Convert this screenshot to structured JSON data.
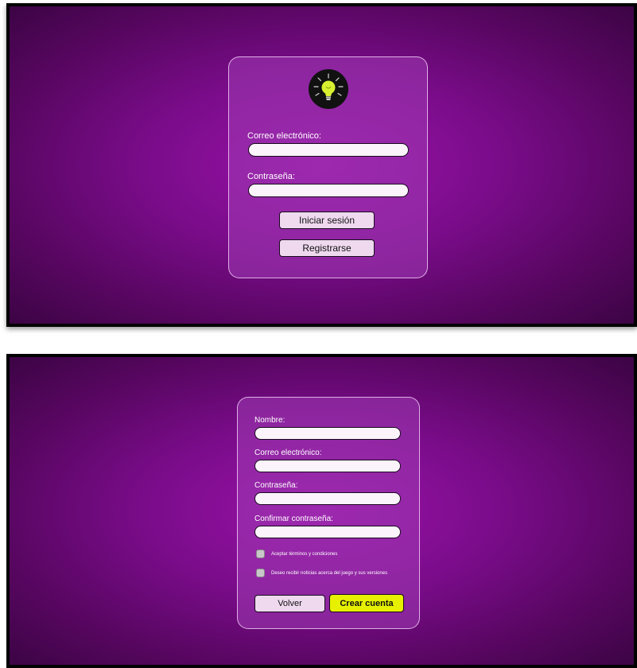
{
  "login": {
    "logo_icon": "lightbulb-icon",
    "email_label": "Correo electrónico:",
    "email_value": "",
    "password_label": "Contraseña:",
    "password_value": "",
    "login_button": "Iniciar sesión",
    "register_button": "Registrarse"
  },
  "register": {
    "name_label": "Nombre:",
    "name_value": "",
    "email_label": "Correo electrónico:",
    "email_value": "",
    "password_label": "Contraseña:",
    "password_value": "",
    "confirm_label": "Confirmar contraseña:",
    "confirm_value": "",
    "terms_label": "Aceptar términos y condiciones",
    "terms_checked": false,
    "news_label": "Deseo recibir noticias acerca del juego y sus versiones",
    "news_checked": false,
    "back_button": "Volver",
    "create_button": "Crear cuenta"
  },
  "colors": {
    "background_center": "#9a12a8",
    "background_edge": "#3c0444",
    "accent": "#e6f000",
    "button": "#efd9ef"
  }
}
